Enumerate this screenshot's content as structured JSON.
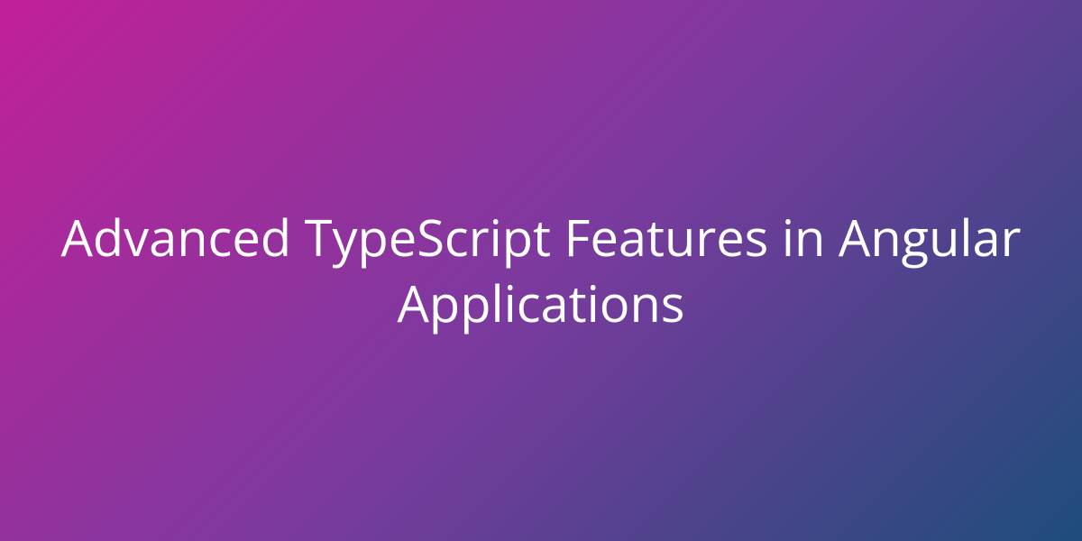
{
  "hero": {
    "title": "Advanced TypeScript Features in Angular Applications"
  }
}
